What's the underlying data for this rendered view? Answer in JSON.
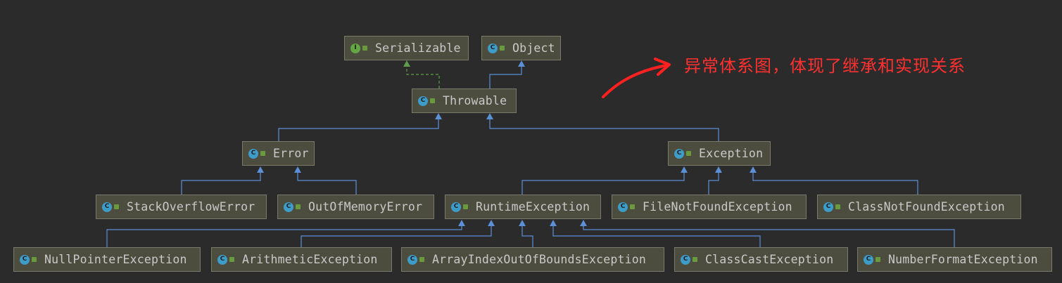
{
  "annotation": {
    "text": "异常体系图，体现了继承和实现关系",
    "color": "#ff3030"
  },
  "colors": {
    "background": "#2b2b2b",
    "node_fill": "#4c4d3e",
    "node_border": "#7a7a6a",
    "inherit_edge": "#5b8fd6",
    "implement_edge": "#5e9e4a",
    "class_icon": "#3e9cc9",
    "interface_icon": "#62a744"
  },
  "nodes": {
    "serializable": {
      "label": "Serializable",
      "kind": "interface",
      "icon": "interface-icon"
    },
    "object": {
      "label": "Object",
      "kind": "class",
      "icon": "class-icon"
    },
    "throwable": {
      "label": "Throwable",
      "kind": "class",
      "icon": "class-icon"
    },
    "error": {
      "label": "Error",
      "kind": "class",
      "icon": "class-icon"
    },
    "exception": {
      "label": "Exception",
      "kind": "class",
      "icon": "class-icon"
    },
    "stackoverflowerror": {
      "label": "StackOverflowError",
      "kind": "class",
      "icon": "class-icon"
    },
    "outofmemoryerror": {
      "label": "OutOfMemoryError",
      "kind": "class",
      "icon": "class-icon"
    },
    "runtimeexception": {
      "label": "RuntimeException",
      "kind": "class",
      "icon": "class-icon"
    },
    "filenotfoundexception": {
      "label": "FileNotFoundException",
      "kind": "class",
      "icon": "class-icon"
    },
    "classnotfoundexception": {
      "label": "ClassNotFoundException",
      "kind": "class",
      "icon": "class-icon"
    },
    "nullpointerexception": {
      "label": "NullPointerException",
      "kind": "class",
      "icon": "class-icon"
    },
    "arithmeticexception": {
      "label": "ArithmeticException",
      "kind": "class",
      "icon": "class-icon"
    },
    "arrayindexoutofboundsexception": {
      "label": "ArrayIndexOutOfBoundsException",
      "kind": "class",
      "icon": "class-icon"
    },
    "classcastexception": {
      "label": "ClassCastException",
      "kind": "class",
      "icon": "class-icon"
    },
    "numberformatexception": {
      "label": "NumberFormatException",
      "kind": "class",
      "icon": "class-icon"
    }
  },
  "edges": [
    {
      "from": "throwable",
      "to": "serializable",
      "type": "implements"
    },
    {
      "from": "throwable",
      "to": "object",
      "type": "extends"
    },
    {
      "from": "error",
      "to": "throwable",
      "type": "extends"
    },
    {
      "from": "exception",
      "to": "throwable",
      "type": "extends"
    },
    {
      "from": "stackoverflowerror",
      "to": "error",
      "type": "extends"
    },
    {
      "from": "outofmemoryerror",
      "to": "error",
      "type": "extends"
    },
    {
      "from": "runtimeexception",
      "to": "exception",
      "type": "extends"
    },
    {
      "from": "filenotfoundexception",
      "to": "exception",
      "type": "extends"
    },
    {
      "from": "classnotfoundexception",
      "to": "exception",
      "type": "extends"
    },
    {
      "from": "nullpointerexception",
      "to": "runtimeexception",
      "type": "extends"
    },
    {
      "from": "arithmeticexception",
      "to": "runtimeexception",
      "type": "extends"
    },
    {
      "from": "arrayindexoutofboundsexception",
      "to": "runtimeexception",
      "type": "extends"
    },
    {
      "from": "classcastexception",
      "to": "runtimeexception",
      "type": "extends"
    },
    {
      "from": "numberformatexception",
      "to": "runtimeexception",
      "type": "extends"
    }
  ]
}
